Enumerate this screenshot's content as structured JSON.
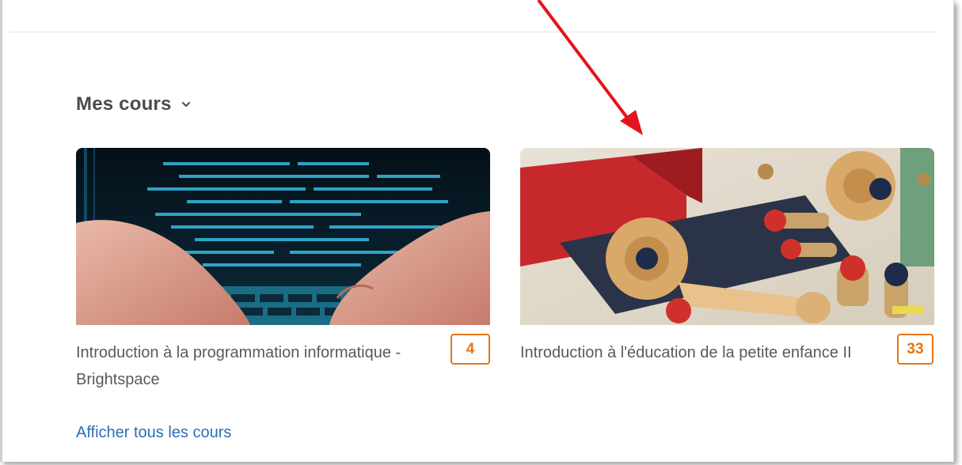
{
  "widget": {
    "title": "Mes cours",
    "view_all": "Afficher tous les cours"
  },
  "courses": [
    {
      "title": "Introduction à la programmation informatique - Brightspace",
      "badge": "4",
      "image": "hands-typing-on-keyboard-with-code-screen"
    },
    {
      "title": "Introduction à l'éducation de la petite enfance II",
      "badge": "33",
      "image": "wooden-toy-pieces-and-screws"
    }
  ],
  "colors": {
    "accent": "#e87511",
    "link": "#2a6fb8",
    "title_text": "#494c4e",
    "arrow": "#e3141b"
  }
}
